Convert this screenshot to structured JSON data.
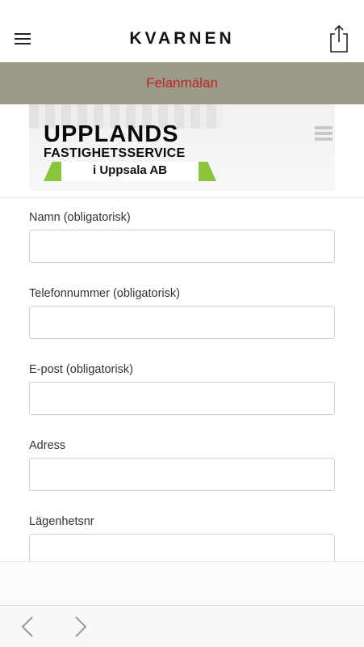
{
  "app": {
    "title": "KVARNEN"
  },
  "icons": {
    "menu": "hamburger-icon",
    "share": "share-icon",
    "back": "chevron-left-icon",
    "forward": "chevron-right-icon",
    "site_menu": "hamburger-icon"
  },
  "banner": {
    "text": "Felanmälan",
    "background": "#9a9a86",
    "color": "#c0222a"
  },
  "logo": {
    "line1": "UPPLANDS",
    "line2": "FASTIGHETSSERVICE",
    "line3": "i Uppsala AB",
    "accent": "#8cc43c"
  },
  "form": {
    "fields": [
      {
        "label": "Namn (obligatorisk)",
        "value": ""
      },
      {
        "label": "Telefonnummer (obligatorisk)",
        "value": ""
      },
      {
        "label": "E-post (obligatorisk)",
        "value": ""
      },
      {
        "label": "Adress",
        "value": ""
      },
      {
        "label": "Lägenhetsnr",
        "value": ""
      }
    ]
  }
}
